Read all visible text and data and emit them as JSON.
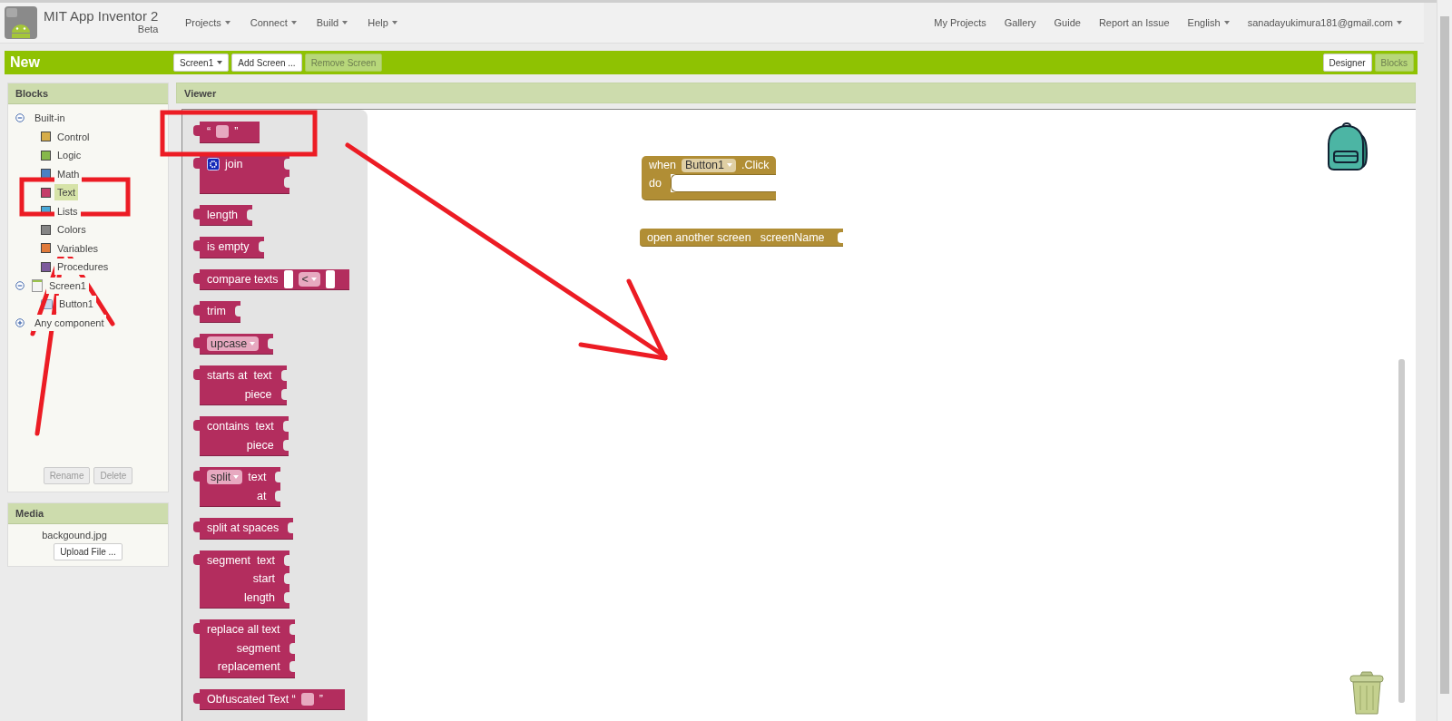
{
  "header": {
    "app_name": "MIT App Inventor 2",
    "edition": "Beta",
    "menus": [
      {
        "label": "Projects",
        "dropdown": true
      },
      {
        "label": "Connect",
        "dropdown": true
      },
      {
        "label": "Build",
        "dropdown": true
      },
      {
        "label": "Help",
        "dropdown": true
      }
    ],
    "links": [
      {
        "label": "My Projects",
        "dropdown": false
      },
      {
        "label": "Gallery",
        "dropdown": false
      },
      {
        "label": "Guide",
        "dropdown": false
      },
      {
        "label": "Report an Issue",
        "dropdown": false
      },
      {
        "label": "English",
        "dropdown": true
      },
      {
        "label": "sanadayukimura181@gmail.com",
        "dropdown": true
      }
    ]
  },
  "project_bar": {
    "title": "New",
    "screen_picker": "Screen1",
    "buttons": [
      {
        "label": "Add Screen ...",
        "disabled": false
      },
      {
        "label": "Remove Screen",
        "disabled": true
      }
    ],
    "views": [
      {
        "label": "Designer",
        "selected": false
      },
      {
        "label": "Blocks",
        "selected": true
      }
    ]
  },
  "blocks_panel": {
    "title": "Blocks",
    "tree": [
      {
        "label": "Built-in",
        "kind": "group",
        "expanded": true,
        "selected": false,
        "children": [
          {
            "label": "Control",
            "kind": "category",
            "color": "#d6ad4a",
            "selected": false
          },
          {
            "label": "Logic",
            "kind": "category",
            "color": "#86b84a",
            "selected": false
          },
          {
            "label": "Math",
            "kind": "category",
            "color": "#4a80c4",
            "selected": false
          },
          {
            "label": "Text",
            "kind": "category",
            "color": "#c43d6a",
            "selected": true
          },
          {
            "label": "Lists",
            "kind": "category",
            "color": "#48a8d8",
            "selected": false
          },
          {
            "label": "Colors",
            "kind": "category",
            "color": "#858585",
            "selected": false
          },
          {
            "label": "Variables",
            "kind": "category",
            "color": "#e07a3a",
            "selected": false
          },
          {
            "label": "Procedures",
            "kind": "category",
            "color": "#7c5a9c",
            "selected": false
          }
        ]
      },
      {
        "label": "Screen1",
        "kind": "screen",
        "expanded": true,
        "selected": false,
        "children": [
          {
            "label": "Button1",
            "kind": "button",
            "selected": false
          }
        ]
      },
      {
        "label": "Any component",
        "kind": "group",
        "expanded": false,
        "selected": false
      }
    ],
    "buttons": [
      {
        "label": "Rename",
        "disabled": true
      },
      {
        "label": "Delete",
        "disabled": true
      }
    ]
  },
  "media_panel": {
    "title": "Media",
    "files": [
      "backgound.jpg"
    ],
    "upload_button": "Upload File ..."
  },
  "viewer": {
    "title": "Viewer",
    "flyout": [
      {
        "kind": "literal",
        "lines": [
          "“",
          "”"
        ]
      },
      {
        "kind": "join",
        "lines": [
          "join"
        ]
      },
      {
        "kind": "inputs",
        "lines": [
          "length"
        ]
      },
      {
        "kind": "inputs",
        "lines": [
          "is empty"
        ]
      },
      {
        "kind": "compare",
        "lines": [
          "compare texts"
        ],
        "option": "<"
      },
      {
        "kind": "inputs",
        "lines": [
          "trim"
        ]
      },
      {
        "kind": "dropdown",
        "option": "upcase"
      },
      {
        "kind": "inputs",
        "lines": [
          "starts at  text",
          "piece"
        ]
      },
      {
        "kind": "inputs",
        "lines": [
          "contains  text",
          "piece"
        ]
      },
      {
        "kind": "dropdown",
        "option": "split",
        "lines": [
          "text",
          "at"
        ]
      },
      {
        "kind": "inputs",
        "lines": [
          "split at spaces"
        ]
      },
      {
        "kind": "inputs",
        "lines": [
          "segment  text",
          "start",
          "length"
        ]
      },
      {
        "kind": "inputs",
        "lines": [
          "replace all text",
          "segment",
          "replacement"
        ]
      },
      {
        "kind": "literal",
        "lines": [
          "Obfuscated Text “",
          "”"
        ]
      }
    ],
    "workspace": [
      {
        "kind": "event",
        "label": "when",
        "component": "Button1",
        "event": ".Click",
        "body_label": "do"
      },
      {
        "kind": "call",
        "label": "open another screen",
        "argument": "screenName"
      }
    ]
  },
  "annotations": [
    {
      "kind": "box"
    },
    {
      "kind": "box"
    },
    {
      "kind": "arrow"
    },
    {
      "kind": "arrow"
    }
  ]
}
